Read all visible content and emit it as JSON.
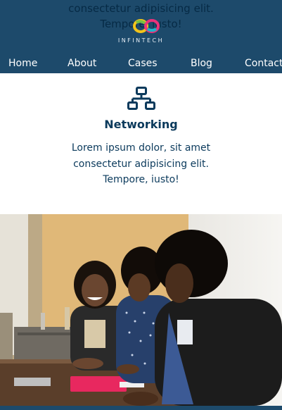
{
  "header": {
    "overflow_text_1": "consectetur adipisicing elit.",
    "overflow_text_2": "Tempore, iusto!",
    "logo_text": "INFINTECH",
    "logo_colors": [
      "#f2c31b",
      "#e9327a",
      "#1fb5c9",
      "#7ac143"
    ]
  },
  "nav": {
    "items": [
      {
        "label": "Home"
      },
      {
        "label": "About"
      },
      {
        "label": "Cases"
      },
      {
        "label": "Blog"
      },
      {
        "label": "Contact"
      }
    ]
  },
  "service": {
    "icon": "network-icon",
    "title": "Networking",
    "body_line_1": "Lorem ipsum dolor, sit amet",
    "body_line_2": "consectetur adipisicing elit.",
    "body_line_3": "Tempore, iusto!"
  },
  "photo": {
    "subject": "team-meeting-photo"
  },
  "colors": {
    "header_bg": "#1d4a6b",
    "accent": "#0b3a5c",
    "page_bg": "#ffffff"
  }
}
